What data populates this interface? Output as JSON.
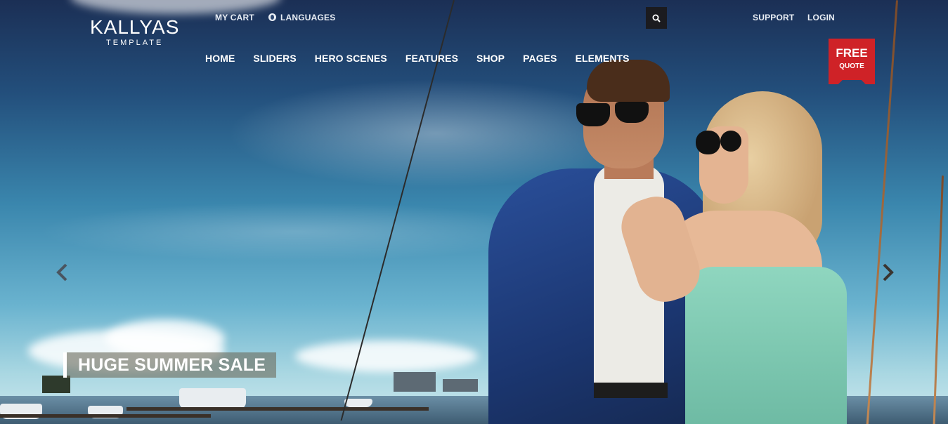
{
  "brand": {
    "name": "KALLYAS",
    "tagline": "TEMPLATE"
  },
  "topbar": {
    "cart_label": "MY CART",
    "languages_label": "LANGUAGES",
    "support_label": "SUPPORT",
    "login_label": "LOGIN"
  },
  "icons": {
    "search": "search-icon",
    "languages": "globe-icon",
    "prev": "chevron-left-icon",
    "next": "chevron-right-icon"
  },
  "nav": {
    "items": [
      {
        "label": "HOME"
      },
      {
        "label": "SLIDERS"
      },
      {
        "label": "HERO SCENES"
      },
      {
        "label": "FEATURES"
      },
      {
        "label": "SHOP"
      },
      {
        "label": "PAGES"
      },
      {
        "label": "ELEMENTS"
      }
    ]
  },
  "quote_badge": {
    "line1": "FREE",
    "line2": "QUOTE",
    "color": "#cf2227"
  },
  "slider": {
    "caption": "HUGE SUMMER SALE"
  }
}
